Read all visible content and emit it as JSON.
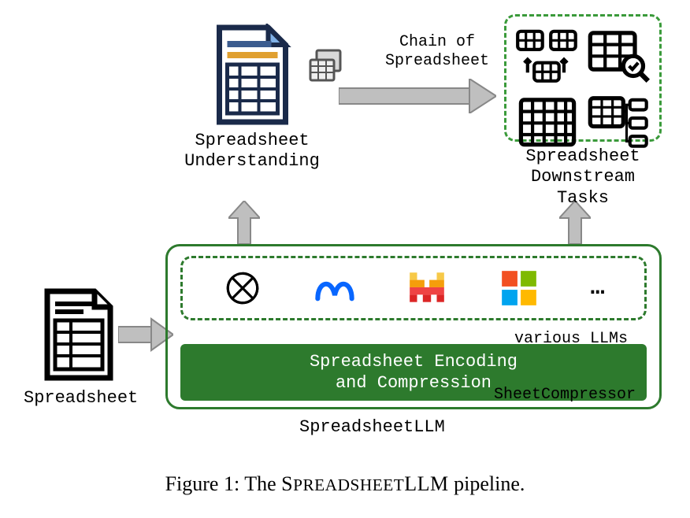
{
  "input": {
    "label": "Spreadsheet"
  },
  "understanding": {
    "label_line1": "Spreadsheet",
    "label_line2": "Understanding"
  },
  "chain": {
    "label_line1": "Chain of",
    "label_line2": "Spreadsheet"
  },
  "tasks": {
    "label_line1": "Spreadsheet",
    "label_line2": "Downstream Tasks"
  },
  "sllm": {
    "llms_label": "various LLMs",
    "encoding_line1": "Spreadsheet Encoding",
    "encoding_line2": "and Compression",
    "compressor_label": "SheetCompressor",
    "box_label": "SpreadsheetLLM",
    "ellipsis": "…"
  },
  "llm_logos": [
    "openai",
    "meta",
    "mistral",
    "microsoft"
  ],
  "caption": {
    "prefix": "Figure 1: The ",
    "name": "SpreadsheetLLM",
    "suffix": " pipeline."
  }
}
